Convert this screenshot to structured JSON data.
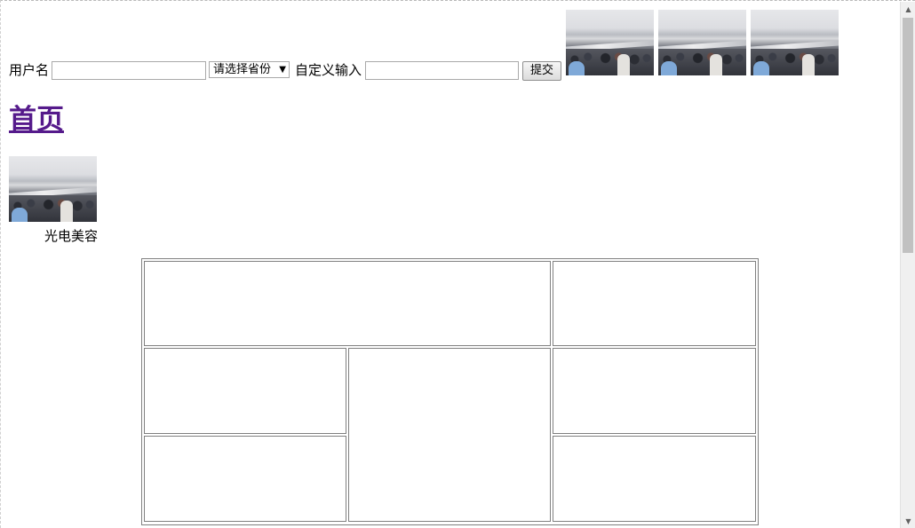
{
  "form": {
    "username_label": "用户名",
    "username_value": "",
    "province_select": {
      "selected": "请选择省份",
      "arrow_icon": "triangle-down-icon"
    },
    "custom_label": "自定义输入",
    "custom_value": "",
    "submit_label": "提交"
  },
  "header_images": [
    {
      "name": "crowd-photo"
    },
    {
      "name": "crowd-photo"
    },
    {
      "name": "crowd-photo"
    }
  ],
  "nav": {
    "home_link": "首页",
    "link_color": "#551a8b"
  },
  "product": {
    "caption": "光电美容"
  },
  "scrollbar": {
    "up_icon": "▲",
    "down_icon": "▼"
  }
}
